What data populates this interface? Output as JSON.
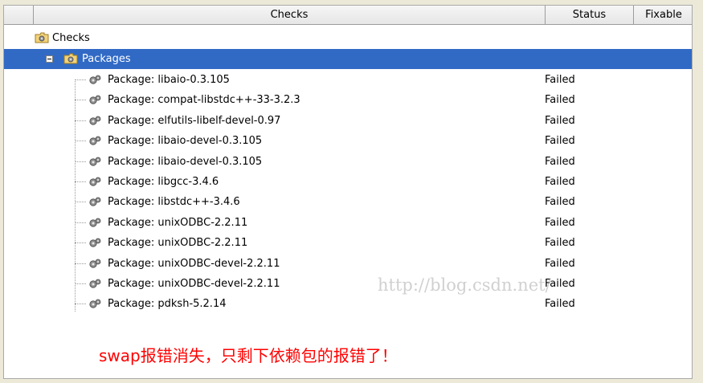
{
  "table": {
    "columns": {
      "checks": "Checks",
      "status": "Status",
      "fixable": "Fixable"
    }
  },
  "tree": {
    "root": {
      "label": "Checks"
    },
    "group": {
      "label": "Packages"
    },
    "items": [
      {
        "label": "Package: libaio-0.3.105",
        "status": "Failed"
      },
      {
        "label": "Package: compat-libstdc++-33-3.2.3",
        "status": "Failed"
      },
      {
        "label": "Package: elfutils-libelf-devel-0.97",
        "status": "Failed"
      },
      {
        "label": "Package: libaio-devel-0.3.105",
        "status": "Failed"
      },
      {
        "label": "Package: libaio-devel-0.3.105",
        "status": "Failed"
      },
      {
        "label": "Package: libgcc-3.4.6",
        "status": "Failed"
      },
      {
        "label": "Package: libstdc++-3.4.6",
        "status": "Failed"
      },
      {
        "label": "Package: unixODBC-2.2.11",
        "status": "Failed"
      },
      {
        "label": "Package: unixODBC-2.2.11",
        "status": "Failed"
      },
      {
        "label": "Package: unixODBC-devel-2.2.11",
        "status": "Failed"
      },
      {
        "label": "Package: unixODBC-devel-2.2.11",
        "status": "Failed"
      },
      {
        "label": "Package: pdksh-5.2.14",
        "status": "Failed"
      }
    ]
  },
  "watermark": "http://blog.csdn.net/",
  "annotation": "swap报错消失，只剩下依赖包的报错了！",
  "colors": {
    "selection": "#316ac5",
    "annotation": "#ff0000"
  }
}
